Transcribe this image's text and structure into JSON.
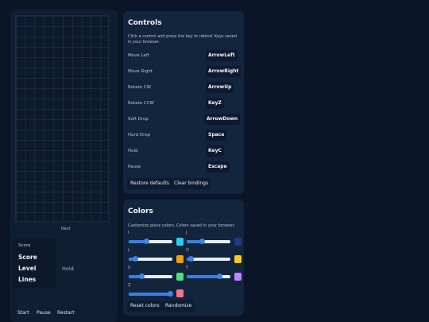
{
  "game": {
    "next_label": "Next",
    "hold_label": "Hold",
    "score_title": "Score",
    "stats": {
      "score": "Score",
      "level": "Level",
      "lines": "Lines"
    },
    "buttons": {
      "start": "Start",
      "pause": "Pause",
      "restart": "Restart"
    }
  },
  "controls": {
    "title": "Controls",
    "description": "Click a control and press the key to rebind. Keys saved in your browser.",
    "bindings": [
      {
        "label": "Move Left",
        "key": "ArrowLeft"
      },
      {
        "label": "Move Right",
        "key": "ArrowRight"
      },
      {
        "label": "Rotate CW",
        "key": "ArrowUp"
      },
      {
        "label": "Rotate CCW",
        "key": "KeyZ"
      },
      {
        "label": "Soft Drop",
        "key": "ArrowDown"
      },
      {
        "label": "Hard Drop",
        "key": "Space"
      },
      {
        "label": "Hold",
        "key": "KeyC"
      },
      {
        "label": "Pause",
        "key": "Escape"
      }
    ],
    "restore_label": "Restore defaults",
    "clear_label": "Clear bindings"
  },
  "colors": {
    "title": "Colors",
    "description": "Customize piece colors. Colors saved in your browser.",
    "pieces": [
      {
        "letter": "I",
        "value": 0.4,
        "color": "#22d3ee"
      },
      {
        "letter": "J",
        "value": 0.35,
        "color": "#1e3a8a"
      },
      {
        "letter": "L",
        "value": 0.15,
        "color": "#f59e0b"
      },
      {
        "letter": "O",
        "value": 0.1,
        "color": "#facc15"
      },
      {
        "letter": "S",
        "value": 0.3,
        "color": "#4ade80"
      },
      {
        "letter": "T",
        "value": 0.75,
        "color": "#c084fc"
      },
      {
        "letter": "Z",
        "value": 0.95,
        "color": "#fb7185"
      }
    ],
    "reset_label": "Reset colors",
    "randomize_label": "Randomize"
  }
}
